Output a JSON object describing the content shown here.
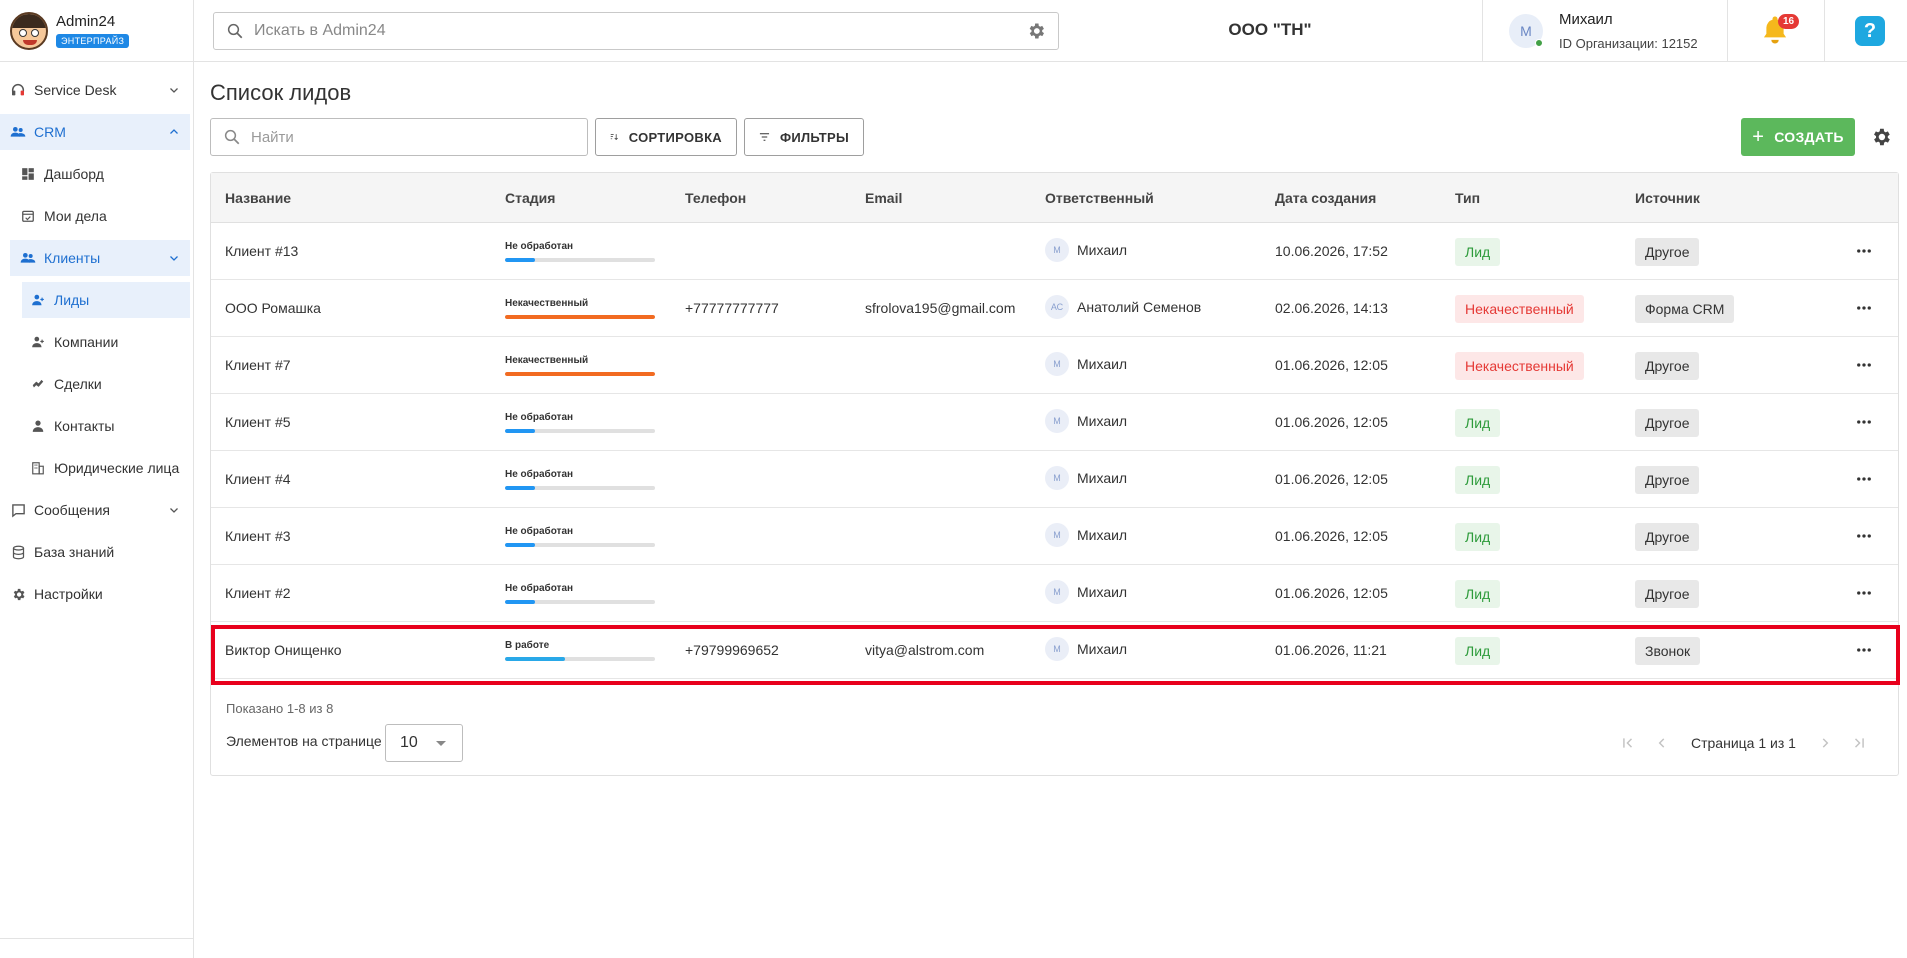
{
  "app": {
    "name": "Admin24",
    "plan": "ЭНТЕРПРАЙЗ",
    "search_placeholder": "Искать в Admin24",
    "org_name": "ООО \"ТН\"",
    "user_name": "Михаил",
    "user_initial": "М",
    "user_org_id": "ID Организации: 12152",
    "notifications_count": "16",
    "help_label": "?"
  },
  "sidebar": {
    "items": [
      {
        "label": "Service Desk",
        "icon": "headset-icon"
      },
      {
        "label": "CRM",
        "icon": "people-icon"
      },
      {
        "label": "Дашборд",
        "icon": "dashboard-icon"
      },
      {
        "label": "Мои дела",
        "icon": "calendar-check-icon"
      },
      {
        "label": "Клиенты",
        "icon": "people-icon"
      },
      {
        "label": "Лиды",
        "icon": "person-add-icon"
      },
      {
        "label": "Компании",
        "icon": "person-add-icon"
      },
      {
        "label": "Сделки",
        "icon": "handshake-icon"
      },
      {
        "label": "Контакты",
        "icon": "person-icon"
      },
      {
        "label": "Юридические лица",
        "icon": "building-icon"
      },
      {
        "label": "Сообщения",
        "icon": "chat-icon"
      },
      {
        "label": "База знаний",
        "icon": "database-icon"
      },
      {
        "label": "Настройки",
        "icon": "gear-icon"
      }
    ]
  },
  "main": {
    "title": "Список лидов",
    "search_placeholder": "Найти",
    "sort_label": "СОРТИРОВКА",
    "filter_label": "ФИЛЬТРЫ",
    "create_label": "СОЗДАТЬ",
    "columns": [
      "Название",
      "Стадия",
      "Телефон",
      "Email",
      "Ответственный",
      "Дата создания",
      "Тип",
      "Источник"
    ],
    "rows": [
      {
        "name": "Клиент #13",
        "stage": "Не обработан",
        "stage_progress": 0.2,
        "stage_color": "#2196f3",
        "phone": "",
        "email": "",
        "resp_initials": "М",
        "resp_name": "Михаил",
        "created": "10.06.2026, 17:52",
        "type": "Лид",
        "type_kind": "lead",
        "source": "Другое"
      },
      {
        "name": "ООО Ромашка",
        "stage": "Некачественный",
        "stage_progress": 1.0,
        "stage_color": "#f26b21",
        "phone": "+77777777777",
        "email": "sfrolova195@gmail.com",
        "resp_initials": "АС",
        "resp_name": "Анатолий Семенов",
        "created": "02.06.2026, 14:13",
        "type": "Некачественный",
        "type_kind": "bad",
        "source": "Форма CRM"
      },
      {
        "name": "Клиент #7",
        "stage": "Некачественный",
        "stage_progress": 1.0,
        "stage_color": "#f26b21",
        "phone": "",
        "email": "",
        "resp_initials": "М",
        "resp_name": "Михаил",
        "created": "01.06.2026, 12:05",
        "type": "Некачественный",
        "type_kind": "bad",
        "source": "Другое"
      },
      {
        "name": "Клиент #5",
        "stage": "Не обработан",
        "stage_progress": 0.2,
        "stage_color": "#2196f3",
        "phone": "",
        "email": "",
        "resp_initials": "М",
        "resp_name": "Михаил",
        "created": "01.06.2026, 12:05",
        "type": "Лид",
        "type_kind": "lead",
        "source": "Другое"
      },
      {
        "name": "Клиент #4",
        "stage": "Не обработан",
        "stage_progress": 0.2,
        "stage_color": "#2196f3",
        "phone": "",
        "email": "",
        "resp_initials": "М",
        "resp_name": "Михаил",
        "created": "01.06.2026, 12:05",
        "type": "Лид",
        "type_kind": "lead",
        "source": "Другое"
      },
      {
        "name": "Клиент #3",
        "stage": "Не обработан",
        "stage_progress": 0.2,
        "stage_color": "#2196f3",
        "phone": "",
        "email": "",
        "resp_initials": "М",
        "resp_name": "Михаил",
        "created": "01.06.2026, 12:05",
        "type": "Лид",
        "type_kind": "lead",
        "source": "Другое"
      },
      {
        "name": "Клиент #2",
        "stage": "Не обработан",
        "stage_progress": 0.2,
        "stage_color": "#2196f3",
        "phone": "",
        "email": "",
        "resp_initials": "М",
        "resp_name": "Михаил",
        "created": "01.06.2026, 12:05",
        "type": "Лид",
        "type_kind": "lead",
        "source": "Другое"
      },
      {
        "name": "Виктор Онищенко",
        "stage": "В работе",
        "stage_progress": 0.4,
        "stage_color": "#29a8e8",
        "phone": "+79799969652",
        "email": "vitya@alstrom.com",
        "resp_initials": "М",
        "resp_name": "Михаил",
        "created": "01.06.2026, 11:21",
        "type": "Лид",
        "type_kind": "lead",
        "source": "Звонок"
      }
    ],
    "shown_text": "Показано 1-8 из 8",
    "per_page_label": "Элементов на странице",
    "per_page_value": "10",
    "page_info": "Страница 1 из 1"
  }
}
